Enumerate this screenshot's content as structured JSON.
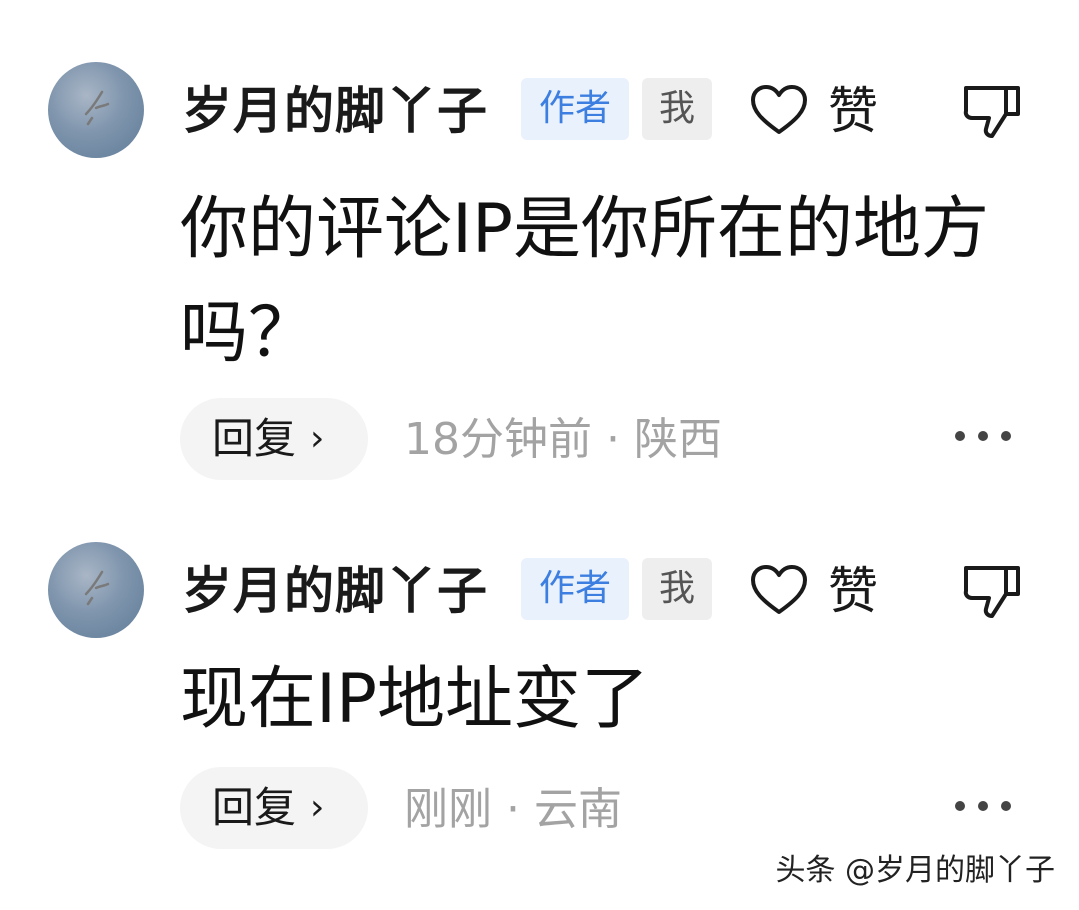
{
  "comments": [
    {
      "author": "岁月的脚丫子",
      "author_tag": "作者",
      "self_tag": "我",
      "like_label": "赞",
      "text": "你的评论IP是你所在的地方吗？",
      "reply_label": "回复",
      "reply_chevron": "›",
      "meta": "18分钟前 · 陕西"
    },
    {
      "author": "岁月的脚丫子",
      "author_tag": "作者",
      "self_tag": "我",
      "like_label": "赞",
      "text": "现在IP地址变了",
      "reply_label": "回复",
      "reply_chevron": "›",
      "meta": "刚刚 · 云南"
    }
  ],
  "watermark": "头条 @岁月的脚丫子",
  "icons": {
    "like": "heart-outline-icon",
    "dislike": "thumbs-down-icon",
    "more": "more-dots-icon",
    "avatar": "seagull-avatar"
  },
  "colors": {
    "author_tag_bg": "#e9f1fd",
    "author_tag_text": "#3d7fe0",
    "meta_text": "#a3a3a3",
    "reply_bg": "#f4f4f4"
  }
}
